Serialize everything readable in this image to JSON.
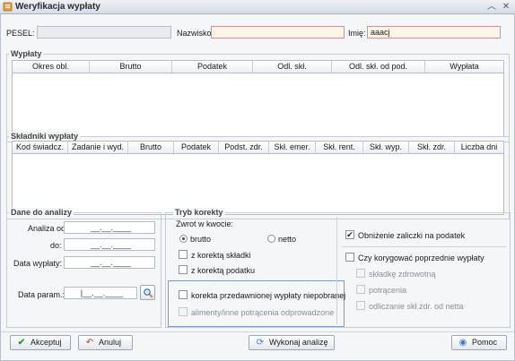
{
  "window": {
    "title": "Weryfikacja wypłaty"
  },
  "header": {
    "pesel_label": "PESEL:",
    "pesel_value": "",
    "nazwisko_label": "Nazwisko:",
    "nazwisko_value": "",
    "imie_label": "Imię:",
    "imie_value": "aaacj"
  },
  "wyplaty": {
    "title": "Wypłaty",
    "columns": [
      "Okres obl.",
      "Brutto",
      "Podatek",
      "Odl. skł.",
      "Odl. skł. od pod.",
      "Wypłata"
    ]
  },
  "skladniki": {
    "title": "Składniki wypłaty",
    "columns": [
      "Kod świadcz.",
      "Zadanie i wyd.",
      "Brutto",
      "Podatek",
      "Podst. zdr.",
      "Skł. emer.",
      "Skł. rent.",
      "Skł. wyp.",
      "Skł. zdr.",
      "Liczba dni"
    ]
  },
  "analiza": {
    "title": "Dane do analizy",
    "analiza_od_label": "Analiza od:",
    "analiza_od_value": "__.__.____",
    "do_label": "do:",
    "do_value": "__.__.____",
    "data_wyplaty_label": "Data wypłaty:",
    "data_wyplaty_value": "__.__.____",
    "data_param_label": "Data param.:",
    "data_param_value": "|__.__.____"
  },
  "tryb": {
    "title": "Tryb korekty",
    "zwrot_label": "Zwrot w kwocie:",
    "brutto": "brutto",
    "netto": "netto",
    "korekta_skladki": "z korektą składki",
    "korekta_podatku": "z korektą podatku",
    "korekta_przedawnionej": "korekta przedawnionej wypłaty niepobranej",
    "alimenty": "alimenty/inne potrącenia odprowadzone"
  },
  "right": {
    "obnizenie": "Obniżenie zaliczki na podatek",
    "czy_korygowac": "Czy korygować poprzednie wypłaty",
    "skladke": "składkę zdrowotną",
    "potracenia": "potrącenia",
    "odliczanie": "odliczanie skł.zdr. od netta"
  },
  "buttons": {
    "akceptuj": "Akceptuj",
    "anuluj": "Anuluj",
    "wykonaj": "Wykonaj analizę",
    "pomoc": "Pomoc"
  },
  "colors": {
    "accent": "#3a7dc9",
    "required_border": "#e08a8a",
    "ok_green": "#2e9a2e",
    "cancel_red": "#c03a2b"
  }
}
